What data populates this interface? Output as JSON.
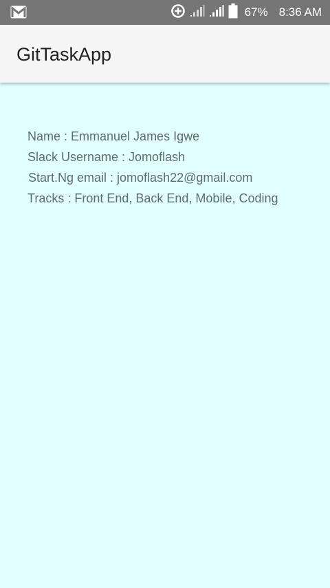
{
  "status_bar": {
    "icons": [
      "gmail-icon",
      "data-saver-icon",
      "signal-icon",
      "signal-icon",
      "battery-icon"
    ],
    "battery_percent": "67%",
    "time": "8:36 AM"
  },
  "app_bar": {
    "title": "GitTaskApp"
  },
  "profile": {
    "name_line": "Name : Emmanuel James Igwe",
    "slack_line": "Slack Username : Jomoflash",
    "email_line": "Start.Ng email : jomoflash22@gmail.com",
    "tracks_line": "Tracks : Front End, Back End, Mobile, Coding"
  },
  "colors": {
    "status_bar": "#757575",
    "app_bar": "#f5f5f5",
    "background": "#e0fffe",
    "text": "#5f6c6c",
    "title": "#212121"
  }
}
